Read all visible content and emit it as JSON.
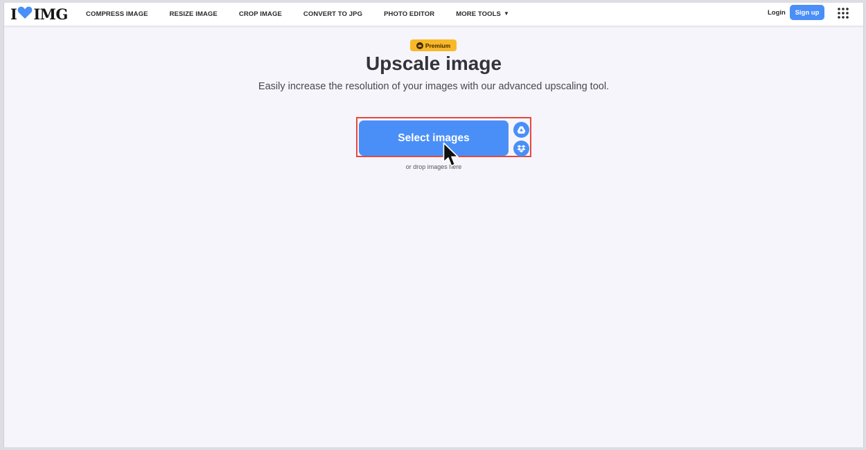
{
  "logo": {
    "text_left": "I",
    "text_right": "IMG"
  },
  "nav": {
    "links": [
      "COMPRESS IMAGE",
      "RESIZE IMAGE",
      "CROP IMAGE",
      "CONVERT TO JPG",
      "PHOTO EDITOR",
      "MORE TOOLS"
    ],
    "login": "Login",
    "signup": "Sign up"
  },
  "hero": {
    "badge": "Premium",
    "title": "Upscale image",
    "subtitle": "Easily increase the resolution of your images with our advanced upscaling tool.",
    "select_button": "Select images",
    "drop_hint": "or drop images here"
  },
  "colors": {
    "accent": "#4a8ff7",
    "heart": "#4a8ff7",
    "badge": "#f9b828",
    "highlight": "#e5473e",
    "background": "#f6f5fb"
  },
  "icons": {
    "apps": "grid-icon",
    "google_drive": "google-drive-icon",
    "dropbox": "dropbox-icon",
    "premium": "crown-icon",
    "more_tools": "caret-down-icon"
  }
}
